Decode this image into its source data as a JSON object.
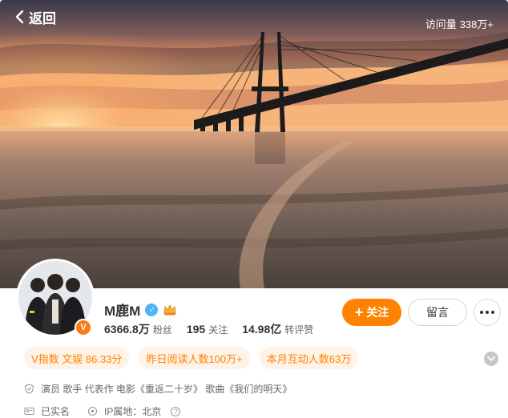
{
  "header": {
    "back_label": "返回",
    "visits_label": "访问量",
    "visits_value": "338万+"
  },
  "profile": {
    "name": "M鹿M",
    "gender_symbol": "♂",
    "verified_badge": "V",
    "stats": [
      {
        "value": "6366.8万",
        "label": "粉丝"
      },
      {
        "value": "195",
        "label": "关注"
      },
      {
        "value": "14.98亿",
        "label": "转评赞"
      }
    ]
  },
  "actions": {
    "follow_plus": "+",
    "follow_label": "关注",
    "message_label": "留言"
  },
  "tags": [
    "V指数 文娱 86.33分",
    "昨日阅读人数100万+",
    "本月互动人数63万"
  ],
  "info": {
    "description": "演员 歌手 代表作 电影《重返二十岁》 歌曲《我们的明天》",
    "realname": "已实名",
    "ip_label": "IP属地：北京"
  },
  "colors": {
    "accent": "#ff8200",
    "tag_bg": "#fff2e6",
    "gender": "#4fb4f5"
  }
}
